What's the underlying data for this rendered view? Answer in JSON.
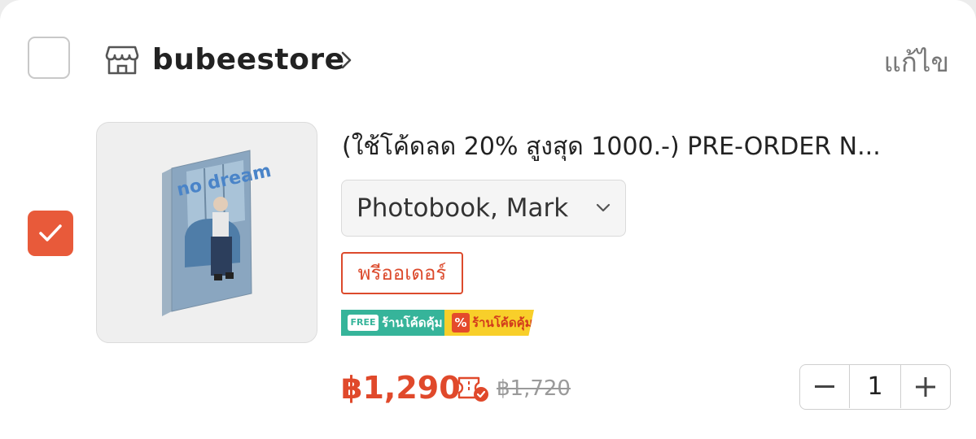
{
  "shop": {
    "name": "bubeestore",
    "edit_label": "แก้ไข",
    "checked": false
  },
  "item": {
    "checked": true,
    "title": "(ใช้โค้ดลด 20% สูงสุด 1000.-) PRE-ORDER  N...",
    "variant": "Photobook, Mark",
    "badge": "พรีออเดอร์",
    "promos": {
      "free_tag": "FREE",
      "free_label": "ร้านโค้ดคุ้ม",
      "discount_tag": "%",
      "discount_label": "ร้านโค้ดคุ้ม"
    },
    "price": "฿1,290",
    "original_price": "฿1,720",
    "quantity": "1"
  },
  "colors": {
    "accent": "#e85a3a",
    "price": "#e0492b",
    "free_promo": "#36b49a",
    "discount_promo": "#f8cf2a"
  },
  "icons": {
    "store": "store-icon",
    "chevron": "chevron-right-icon",
    "dropdown": "chevron-down-icon",
    "voucher": "voucher-icon",
    "minus": "minus-icon",
    "plus": "plus-icon"
  }
}
